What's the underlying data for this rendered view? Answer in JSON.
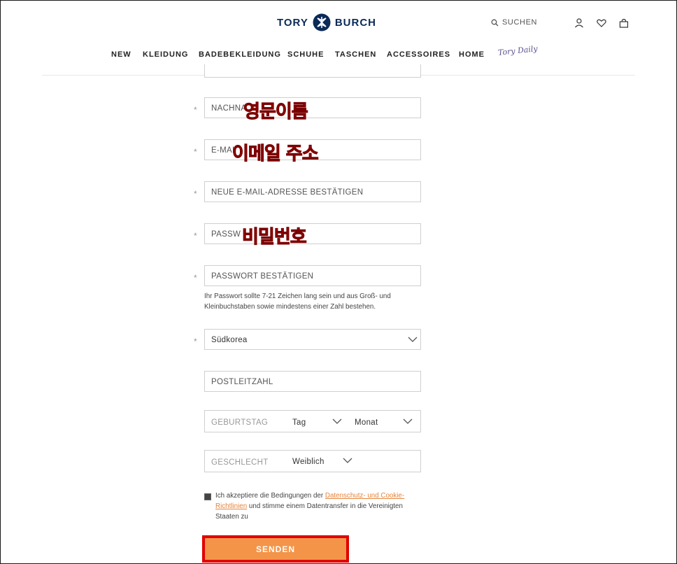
{
  "header": {
    "brand_left": "TORY",
    "brand_right": "BURCH",
    "search_label": "SUCHEN",
    "flag_colors": [
      "#000000",
      "#dd0000",
      "#ffce00"
    ],
    "icons": [
      "search-icon",
      "flag-icon",
      "account-icon",
      "wishlist-icon",
      "bag-icon"
    ]
  },
  "nav": {
    "items": [
      "NEW",
      "KLEIDUNG",
      "BADEBEKLEIDUNG",
      "SCHUHE",
      "TASCHEN",
      "ACCESSOIRES",
      "HOME"
    ],
    "tory_diary": "Tory Daily"
  },
  "form": {
    "lastname_placeholder": "NACHNA",
    "email_placeholder": "E-MAI",
    "email_confirm_placeholder": "NEUE E-MAIL-ADRESSE BESTÄTIGEN",
    "password_placeholder": "PASSW",
    "password_confirm_placeholder": "PASSWORT BESTÄTIGEN",
    "password_hint": "Ihr Passwort sollte 7-21 Zeichen lang sein und aus Groß- und Kleinbuchstaben sowie mindestens einer Zahl bestehen.",
    "country_value": "Südkorea",
    "postcode_placeholder": "POSTLEITZAHL",
    "birthday_label": "GEBURTSTAG",
    "birthday_day": "Tag",
    "birthday_month": "Monat",
    "gender_label": "GESCHLECHT",
    "gender_value": "Weiblich",
    "required_mark": "*"
  },
  "consent": {
    "text_before": "Ich akzeptiere die Bedingungen der ",
    "link_text": "Datenschutz- und Cookie-Richtlinien",
    "text_after": " und stimme einem Datentransfer in die Vereinigten Staaten zu",
    "checked": true
  },
  "submit_label": "SENDEN",
  "annotations": {
    "lastname_note": "영문이름",
    "email_note": "이메일 주소",
    "password_note": "비밀번호",
    "highlight_color": "#e00000"
  }
}
